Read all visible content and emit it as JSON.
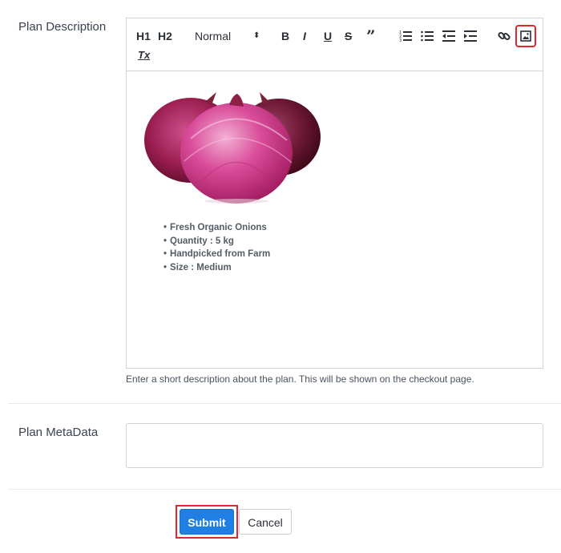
{
  "form": {
    "description_label": "Plan Description",
    "description_help": "Enter a short description about the plan. This will be shown on the checkout page.",
    "metadata_label": "Plan MetaData",
    "metadata_value": ""
  },
  "toolbar": {
    "h1": "H1",
    "h2": "H2",
    "format_select": "Normal",
    "bold": "B",
    "italic": "I",
    "underline": "U",
    "strike": "S",
    "quote": "”",
    "clean": "Tx",
    "icons": [
      "ordered-list-icon",
      "bullet-list-icon",
      "outdent-icon",
      "indent-icon",
      "link-icon",
      "image-icon"
    ]
  },
  "content": {
    "image_alt": "red onions",
    "bullets": [
      "Fresh Organic Onions",
      "Quantity : 5 kg",
      "Handpicked from Farm",
      "Size : Medium"
    ]
  },
  "buttons": {
    "submit": "Submit",
    "cancel": "Cancel"
  },
  "colors": {
    "accent": "#1f7fe3",
    "highlight": "#e3262f"
  }
}
